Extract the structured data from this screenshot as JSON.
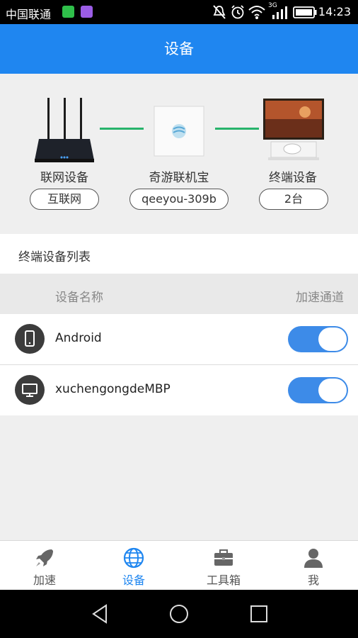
{
  "status_bar": {
    "carrier": "中国联通",
    "time": "14:23",
    "network": "3G",
    "icons": [
      "wechat-icon",
      "photo-app-icon",
      "mute-icon",
      "alarm-icon",
      "wifi-icon",
      "signal-icon",
      "battery-icon"
    ],
    "colors": {
      "wechat": "#2fbf4a",
      "photo_app": "#9b5de5"
    }
  },
  "header": {
    "title": "设备"
  },
  "topology": {
    "nodes": [
      {
        "label": "联网设备",
        "value": "互联网",
        "icon": "router-icon"
      },
      {
        "label": "奇游联机宝",
        "value": "qeeyou-309b",
        "icon": "qeeyou-box-icon"
      },
      {
        "label": "终端设备",
        "value": "2台",
        "icon": "monitor-console-icon"
      }
    ],
    "link_color": "#27b36b"
  },
  "device_list": {
    "title": "终端设备列表",
    "columns": {
      "name": "设备名称",
      "accel": "加速通道"
    },
    "devices": [
      {
        "name": "Android",
        "icon": "phone-icon",
        "accelerated": true
      },
      {
        "name": "xuchengongdeMBP",
        "icon": "desktop-icon",
        "accelerated": true
      }
    ]
  },
  "tabs": [
    {
      "label": "加速",
      "icon": "rocket-icon",
      "active": false
    },
    {
      "label": "设备",
      "icon": "globe-icon",
      "active": true
    },
    {
      "label": "工具箱",
      "icon": "toolbox-icon",
      "active": false
    },
    {
      "label": "我",
      "icon": "user-icon",
      "active": false
    }
  ],
  "nav_bar": {
    "buttons": [
      "back-icon",
      "home-icon",
      "recents-icon"
    ]
  },
  "colors": {
    "primary": "#1f86f0",
    "toggle_on": "#3d8be8"
  }
}
